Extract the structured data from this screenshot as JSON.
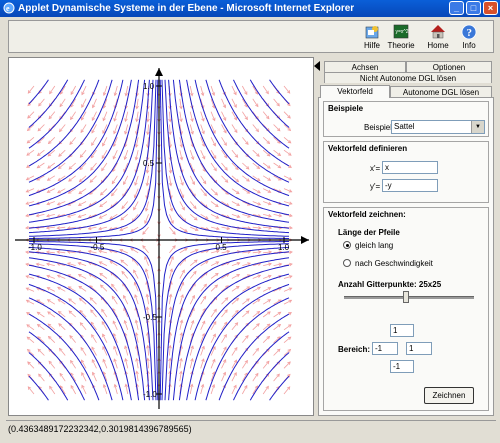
{
  "window": {
    "title": "Applet Dynamische Systeme in der Ebene - Microsoft Internet Explorer"
  },
  "toolbar": [
    {
      "label": "Hilfe",
      "icon": "help-icon"
    },
    {
      "label": "Theorie",
      "icon": "theory-icon"
    },
    {
      "label": "Home",
      "icon": "home-icon"
    },
    {
      "label": "Info",
      "icon": "info-icon"
    }
  ],
  "plot": {
    "ticks_x": [
      "-1.0",
      "-0.5",
      "0.5",
      "1.0"
    ],
    "ticks_y": [
      "1.0",
      "0.5",
      "-0.5",
      "-1.0"
    ],
    "xrange": [
      -1.0,
      1.0
    ],
    "yrange": [
      -1.0,
      1.0
    ],
    "field": "saddle x'=x, y'=-y",
    "colors": {
      "arrows": "#f2a0a0",
      "trajectories": "#2020c8"
    }
  },
  "tabs": {
    "row1": [
      "Achsen",
      "Optionen"
    ],
    "row2": [
      "Nicht Autonome DGL lösen"
    ],
    "row3": [
      "Vektorfeld",
      "Autonome DGL lösen"
    ]
  },
  "beispiele": {
    "title": "Beispiele",
    "label": "Beispiel",
    "value": "Sattel"
  },
  "definieren": {
    "title": "Vektorfeld definieren",
    "xlabel": "x'=",
    "xvalue": "x",
    "ylabel": "y'=",
    "yvalue": "-y"
  },
  "zeichnen": {
    "title": "Vektorfeld zeichnen:",
    "laenge": "Länge der Pfeile",
    "opt1": "gleich lang",
    "opt2": "nach Geschwindigkeit",
    "gitter": "Anzahl Gitterpunkte: 25x25",
    "gitter_value": 25,
    "bereich": "Bereich:",
    "b_top": "1",
    "b_left": "-1",
    "b_right": "1",
    "b_bottom": "-1",
    "button": "Zeichnen"
  },
  "status": "(0.4363489172232342,0.3019814396789565)"
}
